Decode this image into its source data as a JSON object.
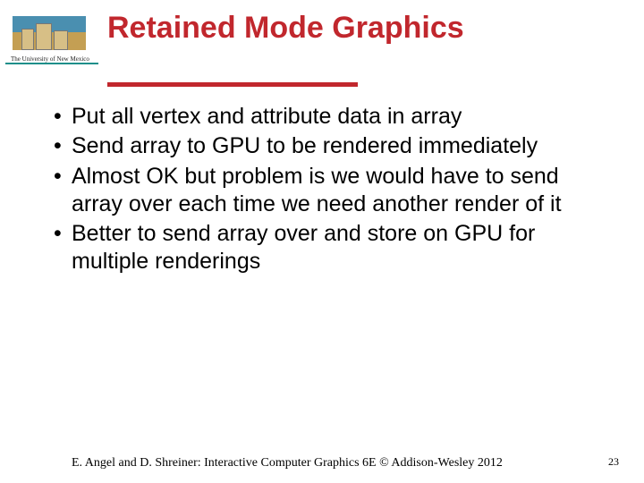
{
  "header": {
    "logo_caption": "The University of New Mexico",
    "title": "Retained Mode Graphics"
  },
  "bullets": [
    "Put all vertex and attribute data in array",
    "Send array to GPU to be rendered immediately",
    "Almost OK but problem is we would have to send array over each time we need another render of it",
    "Better to send array over and store on GPU for multiple renderings"
  ],
  "footer": {
    "attribution": "E. Angel and D. Shreiner: Interactive Computer Graphics 6E © Addison-Wesley 2012",
    "page_number": "23"
  }
}
